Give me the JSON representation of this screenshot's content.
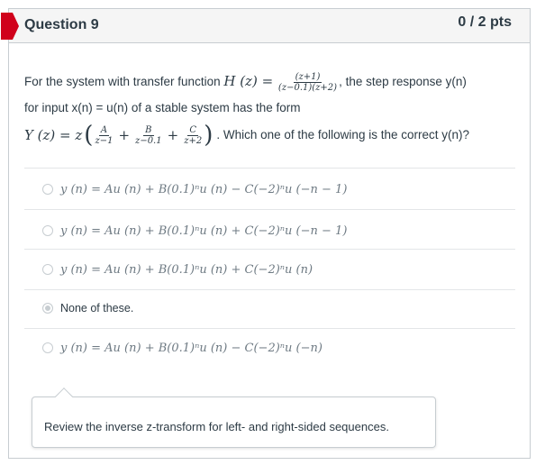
{
  "question": {
    "title": "Question 9",
    "points": "0 / 2 pts",
    "flag_color": "#d0011b"
  },
  "text": {
    "line1_pre": "For the system with transfer function ",
    "H_lhs": "H (z) =",
    "H_num": "(z+1)",
    "H_den": "(z−0.1)(z+2)",
    "line1_post": ", the step response y(n)",
    "line2": "for input x(n) = u(n) of a stable system has the form",
    "Y_lhs": "Y (z) = z",
    "A_num": "A",
    "A_den": "z−1",
    "B_num": "B",
    "B_den": "z−0.1",
    "C_num": "C",
    "C_den": "z+2",
    "line3_post": ". Which one of the following is the correct y(n)?"
  },
  "options": [
    {
      "label": "y (n) = Au (n) + B(0.1)ⁿu (n) − C(−2)ⁿu (−n − 1)",
      "selected": false
    },
    {
      "label": "y (n) = Au (n) + B(0.1)ⁿu (n) + C(−2)ⁿu (−n − 1)",
      "selected": false
    },
    {
      "label": "y (n) = Au (n) + B(0.1)ⁿu (n) + C(−2)ⁿu (n)",
      "selected": false
    },
    {
      "label": "None of these.",
      "selected": true
    },
    {
      "label": "y (n) = Au (n) + B(0.1)ⁿu (n) − C(−2)ⁿu (−n)",
      "selected": false
    }
  ],
  "feedback": "Review the inverse z-transform for left- and right-sided sequences."
}
